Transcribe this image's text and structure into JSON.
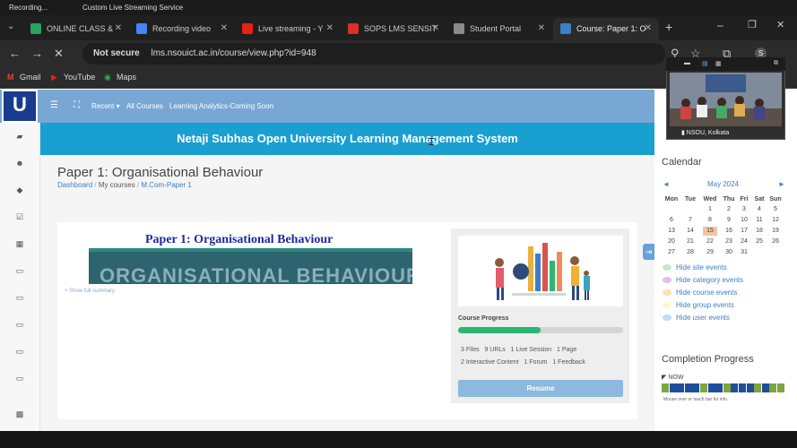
{
  "os_bar": {
    "recording": "Recording...",
    "service": "Custom Live Streaming Service"
  },
  "tabs": [
    {
      "label": "ONLINE CLASS &",
      "fav_color": "#23a55a"
    },
    {
      "label": "Recording video",
      "fav_color": "#4285f4"
    },
    {
      "label": "Live streaming - Y",
      "fav_color": "#e62117"
    },
    {
      "label": "SOPS LMS SENSIT",
      "fav_color": "#d93025"
    },
    {
      "label": "Student Portal",
      "fav_color": "#8a8a8a"
    },
    {
      "label": "Course: Paper 1: O",
      "fav_color": "#3d7fc4"
    }
  ],
  "address": {
    "warning": "Not secure",
    "url": "lms.nsouict.ac.in/course/view.php?id=948"
  },
  "bookmarks": [
    "Gmail",
    "YouTube",
    "Maps"
  ],
  "nav": {
    "recent": "Recent",
    "all_courses": "All Courses",
    "analytics": "Learning Analytics-Coming Soon"
  },
  "logo_text": "U",
  "banner": "Netaji Subhas Open University Learning Management System",
  "page_title": "Paper 1: Organisational Behaviour",
  "breadcrumb": {
    "dashboard": "Dashboard",
    "my_courses": "My courses",
    "course": "M.Com-Paper 1"
  },
  "summary": {
    "title": "Paper 1: Organisational Behaviour",
    "image_text": "ORGANISATIONAL BEHAVIOUR",
    "show_full": "+ Show full summary"
  },
  "progress": {
    "title": "Course Progress",
    "fraction": 0.5,
    "stats_row1": [
      "3 Files",
      "9 URLs",
      "1 Live Session",
      "1 Page"
    ],
    "stats_row2": [
      "2 Interactive Content",
      "1 Forum",
      "1 Feedback"
    ],
    "resume": "Resume"
  },
  "video": {
    "caption": "NSOU, Kolkata"
  },
  "calendar": {
    "heading": "Calendar",
    "month": "May 2024",
    "prev": "◄",
    "next": "►",
    "weekdays": [
      "Mon",
      "Tue",
      "Wed",
      "Thu",
      "Fri",
      "Sat",
      "Sun"
    ],
    "weeks": [
      [
        "",
        "",
        "1",
        "2",
        "3",
        "4",
        "5"
      ],
      [
        "6",
        "7",
        "8",
        "9",
        "10",
        "11",
        "12"
      ],
      [
        "13",
        "14",
        "15",
        "16",
        "17",
        "18",
        "19"
      ],
      [
        "20",
        "21",
        "22",
        "23",
        "24",
        "25",
        "26"
      ],
      [
        "27",
        "28",
        "29",
        "30",
        "31",
        "",
        ""
      ]
    ],
    "today": "15",
    "events": [
      "Hide site events",
      "Hide category events",
      "Hide course events",
      "Hide group events",
      "Hide user events"
    ]
  },
  "completion": {
    "heading": "Completion Progress",
    "now": "NOW",
    "hint": "Mouse over or touch bar for info.",
    "blocks": [
      "#7ea640",
      "#1f4e9a",
      "#1f4e9a",
      "#1f4e9a",
      "#1f4e9a",
      "#7ea640",
      "#1f4e9a",
      "#1f4e9a",
      "#7ea640",
      "#1f4e9a",
      "#1f4e9a",
      "#1f4e9a",
      "#7ea640",
      "#1f4e9a",
      "#7ea640",
      "#7ea640"
    ]
  }
}
